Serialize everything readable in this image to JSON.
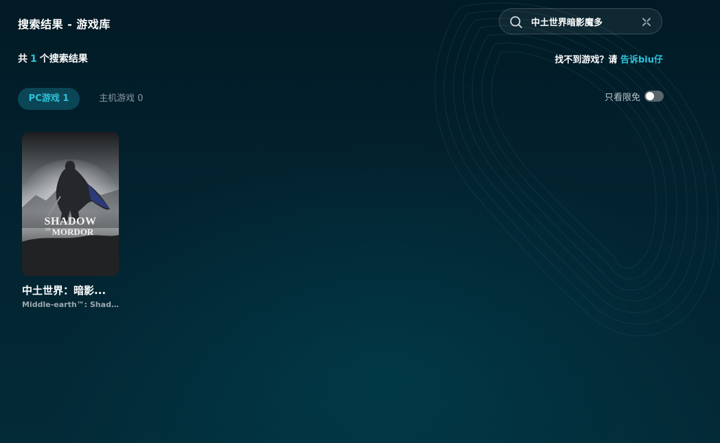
{
  "header": {
    "title": "搜索结果 - 游戏库"
  },
  "search": {
    "value": "中土世界暗影魔多",
    "icon": "search-icon",
    "clear_icon": "close-icon"
  },
  "results": {
    "prefix": "共",
    "count": "1",
    "suffix": "个搜索结果"
  },
  "feedback": {
    "text": "找不到游戏？请 ",
    "link": "告诉biu仔"
  },
  "tabs": [
    {
      "label": "PC游戏 1",
      "active": true
    },
    {
      "label": "主机游戏 0",
      "active": false
    }
  ],
  "filter": {
    "label": "只看限免",
    "enabled": false
  },
  "games": [
    {
      "title": "中土世界：暗影...",
      "subtitle": "Middle-earth™: Shado...",
      "cover_logo_line1": "SHADOW",
      "cover_logo_line2": "MORDOR",
      "cover_logo_of": "OF"
    }
  ],
  "colors": {
    "accent": "#2ec4dc",
    "background": "#03222f",
    "tab_active_bg": "#0b4656"
  }
}
